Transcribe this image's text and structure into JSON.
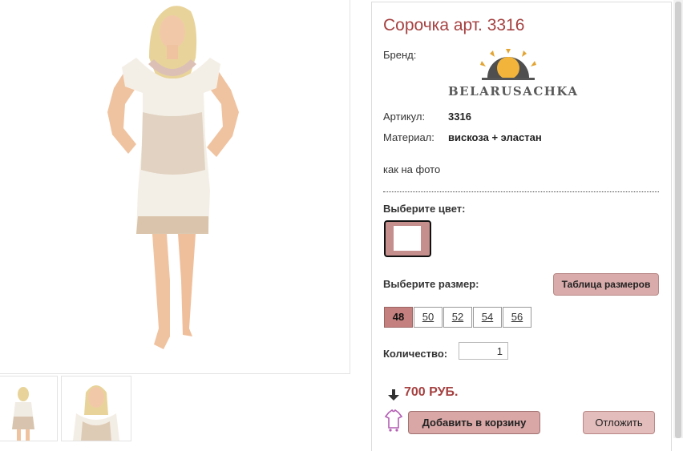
{
  "product": {
    "title": "Сорочка арт. 3316",
    "brand_label": "Бренд:",
    "brand_name": "BELARUSACHKA",
    "article_label": "Артикул:",
    "article_value": "3316",
    "material_label": "Материал:",
    "material_value": "вискоза + эластан",
    "description": "как на фото"
  },
  "color_select": {
    "title": "Выберите цвет:",
    "swatch_color": "#c48f8d"
  },
  "size_select": {
    "title": "Выберите размер:",
    "size_table_button": "Таблица размеров",
    "sizes": [
      "48",
      "50",
      "52",
      "54",
      "56"
    ],
    "selected": "48"
  },
  "quantity": {
    "label": "Количество:",
    "value": "1"
  },
  "price": {
    "value": "700 РУБ."
  },
  "actions": {
    "add_to_cart": "Добавить в корзину",
    "postpone": "Отложить"
  },
  "colors": {
    "accent": "#a64141",
    "button": "#d8a7a6"
  }
}
